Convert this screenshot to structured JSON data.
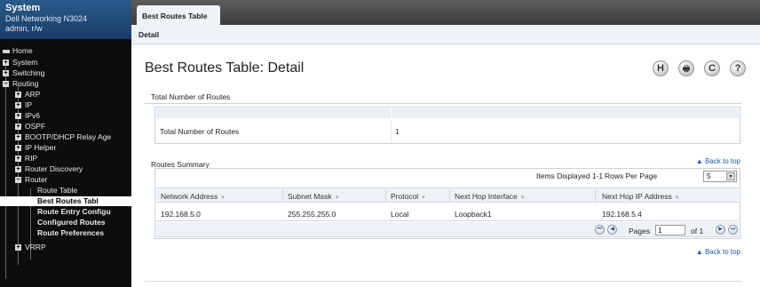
{
  "system": {
    "title": "System",
    "model": "Dell Networking N3024",
    "user": "admin, r/w"
  },
  "nav": {
    "home": "Home",
    "system": "System",
    "switching": "Switching",
    "routing": "Routing",
    "arp": "ARP",
    "ip": "IP",
    "ipv6": "IPv6",
    "ospf": "OSPF",
    "bootp": "BOOTP/DHCP Relay Age",
    "iphelper": "IP Helper",
    "rip": "RIP",
    "router_discovery": "Router Discovery",
    "router": "Router",
    "route_table": "Route Table",
    "best_routes": "Best Routes Tabl",
    "route_entry": "Route Entry Configu",
    "configured_routes": "Configured Routes",
    "route_prefs": "Route Preferences",
    "vrrp": "VRRP",
    "expander_plus": "+",
    "expander_minus": "−"
  },
  "tabs": {
    "active": "Best Routes Table",
    "sub": "Detail"
  },
  "page": {
    "title": "Best Routes Table: Detail"
  },
  "toolbar": {
    "h_icon": "H",
    "print_icon": "🖶",
    "refresh_icon": "C",
    "help_icon": "?"
  },
  "total_section": {
    "title": "Total Number of Routes",
    "label": "Total Number of Routes",
    "value": "1"
  },
  "summary": {
    "title": "Routes Summary",
    "back_to_top": "▲ Back to top",
    "items_displayed": "Items Displayed 1-1",
    "rows_per_page_label": "Rows Per Page",
    "rows_per_page_value": "5",
    "columns": [
      "Network Address",
      "Subnet Mask",
      "Protocol",
      "Next Hop Interface",
      "Next Hop IP Address"
    ],
    "rows": [
      [
        "192.168.5.0",
        "255.255.255.0",
        "Local",
        "Loopback1",
        "192.168.5.4"
      ]
    ],
    "pages_label": "Pages",
    "page_value": "1",
    "of_label": "of 1",
    "sort_glyph": "▾"
  },
  "colors": {
    "nav_bg": "#0d0d0d",
    "header_bg": "#1a3d66",
    "link": "#1e5aa8"
  }
}
